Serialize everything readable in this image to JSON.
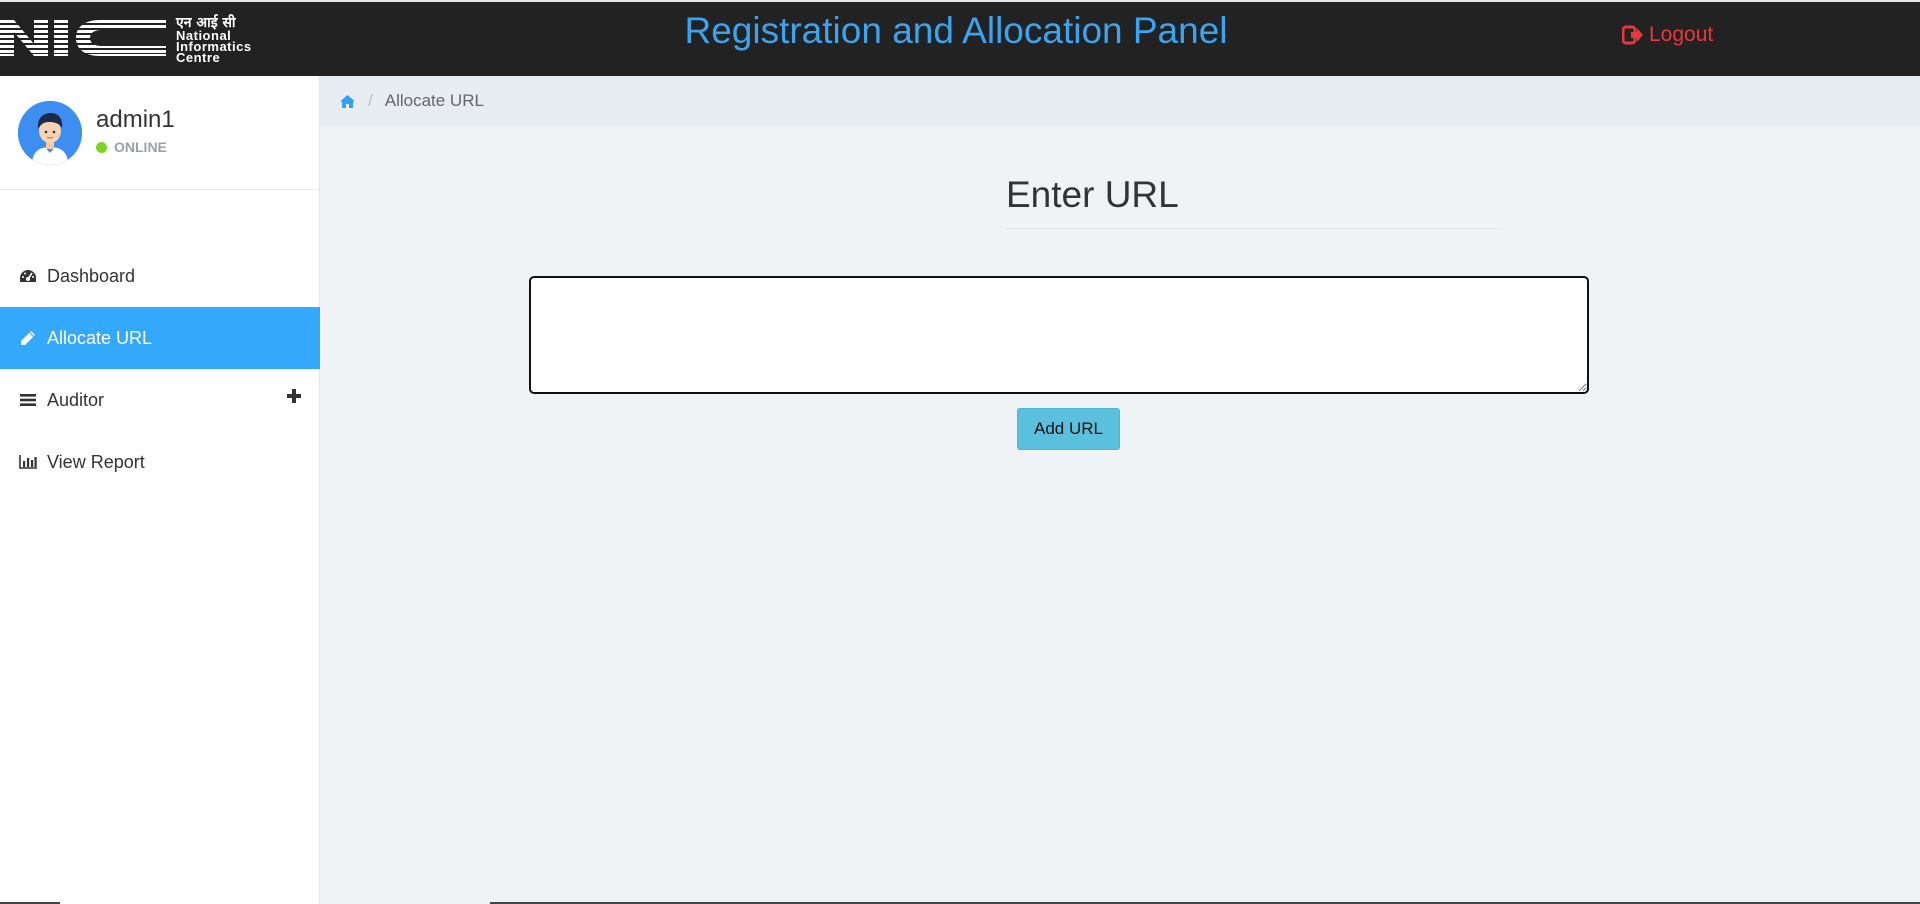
{
  "header": {
    "logo_hindi": "एन आई सी",
    "logo_english_lines": [
      "National",
      "Informatics",
      "Centre"
    ],
    "title": "Registration and Allocation Panel",
    "logout_label": "Logout",
    "title_color": "#3aa4f0",
    "logout_color": "#e8373d"
  },
  "user": {
    "name": "admin1",
    "status": "ONLINE",
    "status_color": "#7ed321"
  },
  "sidebar": {
    "items": [
      {
        "label": "Dashboard",
        "icon": "dashboard-icon",
        "active": false
      },
      {
        "label": "Allocate URL",
        "icon": "pencil-icon",
        "active": true
      },
      {
        "label": "Auditor",
        "icon": "list-icon",
        "active": false,
        "expand_icon": "plus-icon"
      },
      {
        "label": "View Report",
        "icon": "bar-chart-icon",
        "active": false
      }
    ],
    "active_color": "#34a9fb"
  },
  "breadcrumb": {
    "home_icon": "home-icon",
    "current": "Allocate URL"
  },
  "main": {
    "title": "Enter URL",
    "url_input_value": "",
    "add_button_label": "Add URL"
  }
}
